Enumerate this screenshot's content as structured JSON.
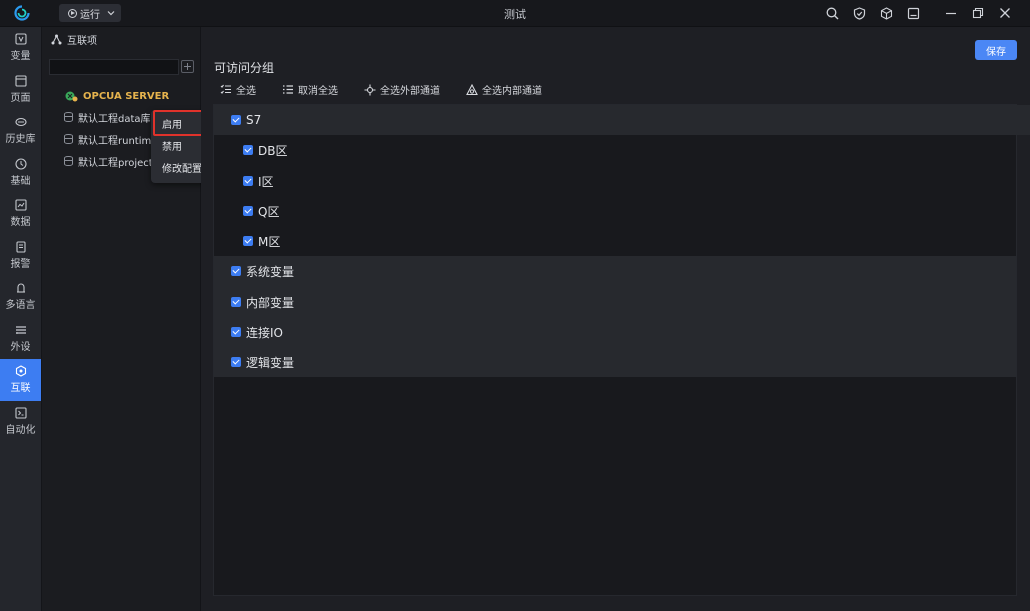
{
  "window": {
    "title": "测试",
    "run_label": "运行"
  },
  "nav": [
    {
      "label": "变量"
    },
    {
      "label": "页面"
    },
    {
      "label": "历史库"
    },
    {
      "label": "基础"
    },
    {
      "label": "数据"
    },
    {
      "label": "报警"
    },
    {
      "label": "多语言"
    },
    {
      "label": "外设"
    },
    {
      "label": "互联",
      "active": true
    },
    {
      "label": "自动化"
    }
  ],
  "tree": {
    "header": "互联项",
    "search_value": "",
    "items": [
      {
        "label": "OPCUA SERVER"
      },
      {
        "label": "默认工程data库"
      },
      {
        "label": "默认工程runtim"
      },
      {
        "label": "默认工程project"
      }
    ],
    "more": "···"
  },
  "context_menu": {
    "items": [
      "启用",
      "禁用",
      "修改配置"
    ]
  },
  "main": {
    "save_label": "保存",
    "section_title": "可访问分组",
    "toolbar": {
      "select_all": "全选",
      "deselect_all": "取消全选",
      "select_external": "全选外部通道",
      "select_internal": "全选内部通道"
    },
    "groups": [
      {
        "label": "S7",
        "checked": true,
        "children": [
          {
            "label": "DB区",
            "checked": true
          },
          {
            "label": "I区",
            "checked": true
          },
          {
            "label": "Q区",
            "checked": true
          },
          {
            "label": "M区",
            "checked": true
          }
        ]
      },
      {
        "label": "系统变量",
        "checked": true
      },
      {
        "label": "内部变量",
        "checked": true
      },
      {
        "label": "连接IO",
        "checked": true
      },
      {
        "label": "逻辑变量",
        "checked": true
      }
    ]
  },
  "colors": {
    "accent": "#3d7df2",
    "highlight_border": "#e0322b",
    "server_text": "#e6b34d"
  }
}
